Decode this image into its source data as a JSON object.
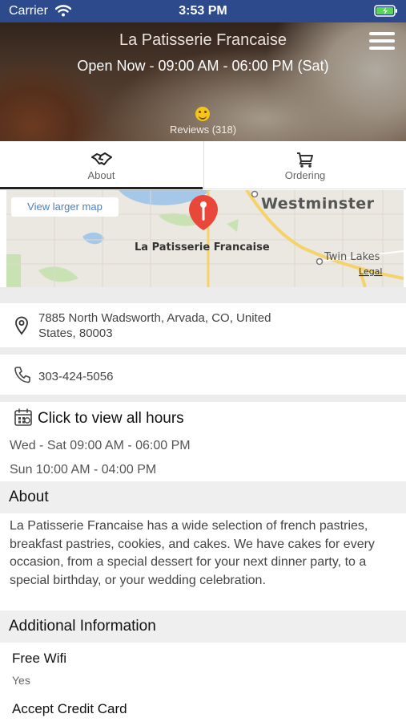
{
  "status_bar": {
    "carrier": "Carrier",
    "time": "3:53 PM"
  },
  "header": {
    "title": "La Patisserie Francaise",
    "hours": "Open Now - 09:00 AM - 06:00 PM (Sat)",
    "reviews": "Reviews (318)"
  },
  "tabs": [
    {
      "label": "About",
      "icon": "handshake-icon",
      "active": true
    },
    {
      "label": "Ordering",
      "icon": "cart-icon",
      "active": false
    }
  ],
  "map": {
    "button": "View larger map",
    "labels": {
      "city": "Westminster",
      "place": "La Patisserie Francaise",
      "area": "Twin Lakes",
      "legal": "Legal"
    }
  },
  "address": "7885 North Wadsworth, Arvada, CO, United States, 80003",
  "phone": "303-424-5056",
  "hours": {
    "title": "Click to view all hours",
    "lines": [
      "Wed - Sat 09:00 AM - 06:00 PM",
      "Sun 10:00 AM - 04:00 PM"
    ]
  },
  "about": {
    "heading": "About",
    "text": "La Patisserie Francaise has a wide selection of french pastries, breakfast pastries, cookies, and cakes. We have cakes for every occasion, from a special dessert for your next dinner party, to a special birthday, or your wedding celebration."
  },
  "additional": {
    "heading": "Additional Information",
    "items": [
      {
        "label": "Free Wifi",
        "value": "Yes"
      },
      {
        "label": "Accept Credit Card",
        "value": ""
      }
    ]
  },
  "colors": {
    "status_bar": "#2d4a8c",
    "pin": "#e8473a",
    "map_link": "#4a80c8"
  }
}
